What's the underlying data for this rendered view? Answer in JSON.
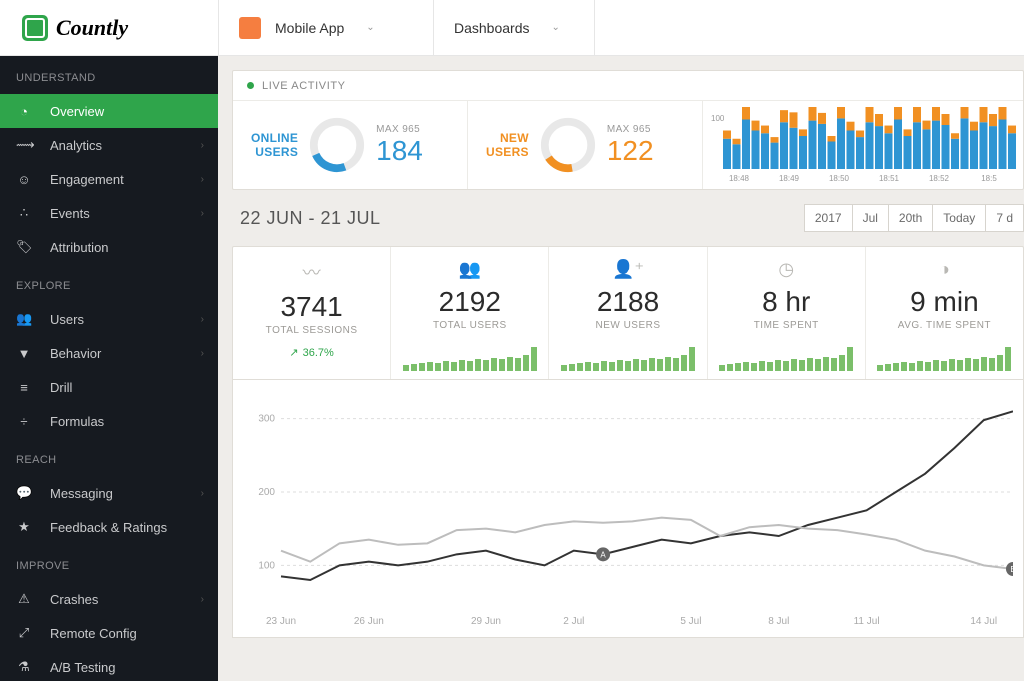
{
  "brand": "Countly",
  "header": {
    "app_name": "Mobile App",
    "menu_name": "Dashboards"
  },
  "sidebar": {
    "sections": [
      {
        "title": "UNDERSTAND",
        "items": [
          {
            "label": "Overview",
            "active": true,
            "expandable": false
          },
          {
            "label": "Analytics",
            "expandable": true
          },
          {
            "label": "Engagement",
            "expandable": true
          },
          {
            "label": "Events",
            "expandable": true
          },
          {
            "label": "Attribution",
            "expandable": false
          }
        ]
      },
      {
        "title": "EXPLORE",
        "items": [
          {
            "label": "Users",
            "expandable": true
          },
          {
            "label": "Behavior",
            "expandable": true
          },
          {
            "label": "Drill",
            "expandable": false
          },
          {
            "label": "Formulas",
            "expandable": false
          }
        ]
      },
      {
        "title": "REACH",
        "items": [
          {
            "label": "Messaging",
            "expandable": true
          },
          {
            "label": "Feedback & Ratings",
            "expandable": false
          }
        ]
      },
      {
        "title": "IMPROVE",
        "items": [
          {
            "label": "Crashes",
            "expandable": true
          },
          {
            "label": "Remote Config",
            "expandable": false
          },
          {
            "label": "A/B Testing",
            "expandable": false
          }
        ]
      }
    ]
  },
  "live": {
    "header": "LIVE ACTIVITY",
    "online": {
      "label_top": "ONLINE",
      "label_bot": "USERS",
      "max_label": "MAX 965",
      "value": "184"
    },
    "new": {
      "label_top": "NEW",
      "label_bot": "USERS",
      "max_label": "MAX 965",
      "value": "122"
    },
    "chart_yaxis": "100",
    "chart_xticks": [
      "18:48",
      "18:49",
      "18:50",
      "18:51",
      "18:52",
      "18:5"
    ]
  },
  "range": {
    "title": "22 JUN - 21 JUL",
    "buttons": [
      "2017",
      "Jul",
      "20th",
      "Today",
      "7 d"
    ]
  },
  "metrics": [
    {
      "key": "sessions",
      "value": "3741",
      "label": "TOTAL SESSIONS",
      "trend": "36.7%"
    },
    {
      "key": "users",
      "value": "2192",
      "label": "TOTAL USERS"
    },
    {
      "key": "newusers",
      "value": "2188",
      "label": "NEW USERS"
    },
    {
      "key": "timespent",
      "value": "8 hr",
      "label": "TIME SPENT"
    },
    {
      "key": "avgtime",
      "value": "9 min",
      "label": "AVG. TIME SPENT"
    }
  ],
  "chart_data": {
    "type": "line",
    "x_ticks": [
      "23 Jun",
      "26 Jun",
      "29 Jun",
      "2 Jul",
      "5 Jul",
      "8 Jul",
      "11 Jul",
      "14 Jul"
    ],
    "y_ticks": [
      100,
      200,
      300
    ],
    "ylim": [
      50,
      320
    ],
    "series": [
      {
        "name": "A",
        "color": "#333333",
        "values": [
          85,
          80,
          100,
          105,
          100,
          105,
          115,
          120,
          108,
          100,
          120,
          115,
          125,
          135,
          130,
          140,
          145,
          140,
          155,
          165,
          175,
          200,
          225,
          260,
          298,
          310
        ]
      },
      {
        "name": "B",
        "color": "#bdbdbd",
        "values": [
          120,
          105,
          130,
          135,
          128,
          130,
          148,
          150,
          145,
          155,
          160,
          158,
          160,
          165,
          162,
          140,
          152,
          155,
          150,
          148,
          142,
          135,
          120,
          112,
          100,
          95
        ]
      }
    ],
    "annotations": [
      {
        "label": "A",
        "x_index": 11
      },
      {
        "label": "B",
        "x_index": 25
      }
    ]
  },
  "live_bars": {
    "blue": [
      55,
      45,
      90,
      70,
      65,
      48,
      85,
      75,
      60,
      88,
      82,
      50,
      92,
      70,
      58,
      85,
      78,
      65,
      90,
      60,
      85,
      72,
      88,
      80,
      55,
      92,
      70,
      85,
      78,
      90,
      65,
      88
    ],
    "orange": [
      15,
      10,
      30,
      18,
      14,
      10,
      22,
      28,
      12,
      35,
      20,
      10,
      40,
      16,
      12,
      30,
      22,
      14,
      38,
      12,
      28,
      16,
      32,
      20,
      10,
      42,
      16,
      30,
      22,
      36,
      14,
      38
    ]
  },
  "spark_heights": [
    6,
    7,
    8,
    9,
    8,
    10,
    9,
    11,
    10,
    12,
    11,
    13,
    12,
    14,
    13,
    16,
    24
  ]
}
